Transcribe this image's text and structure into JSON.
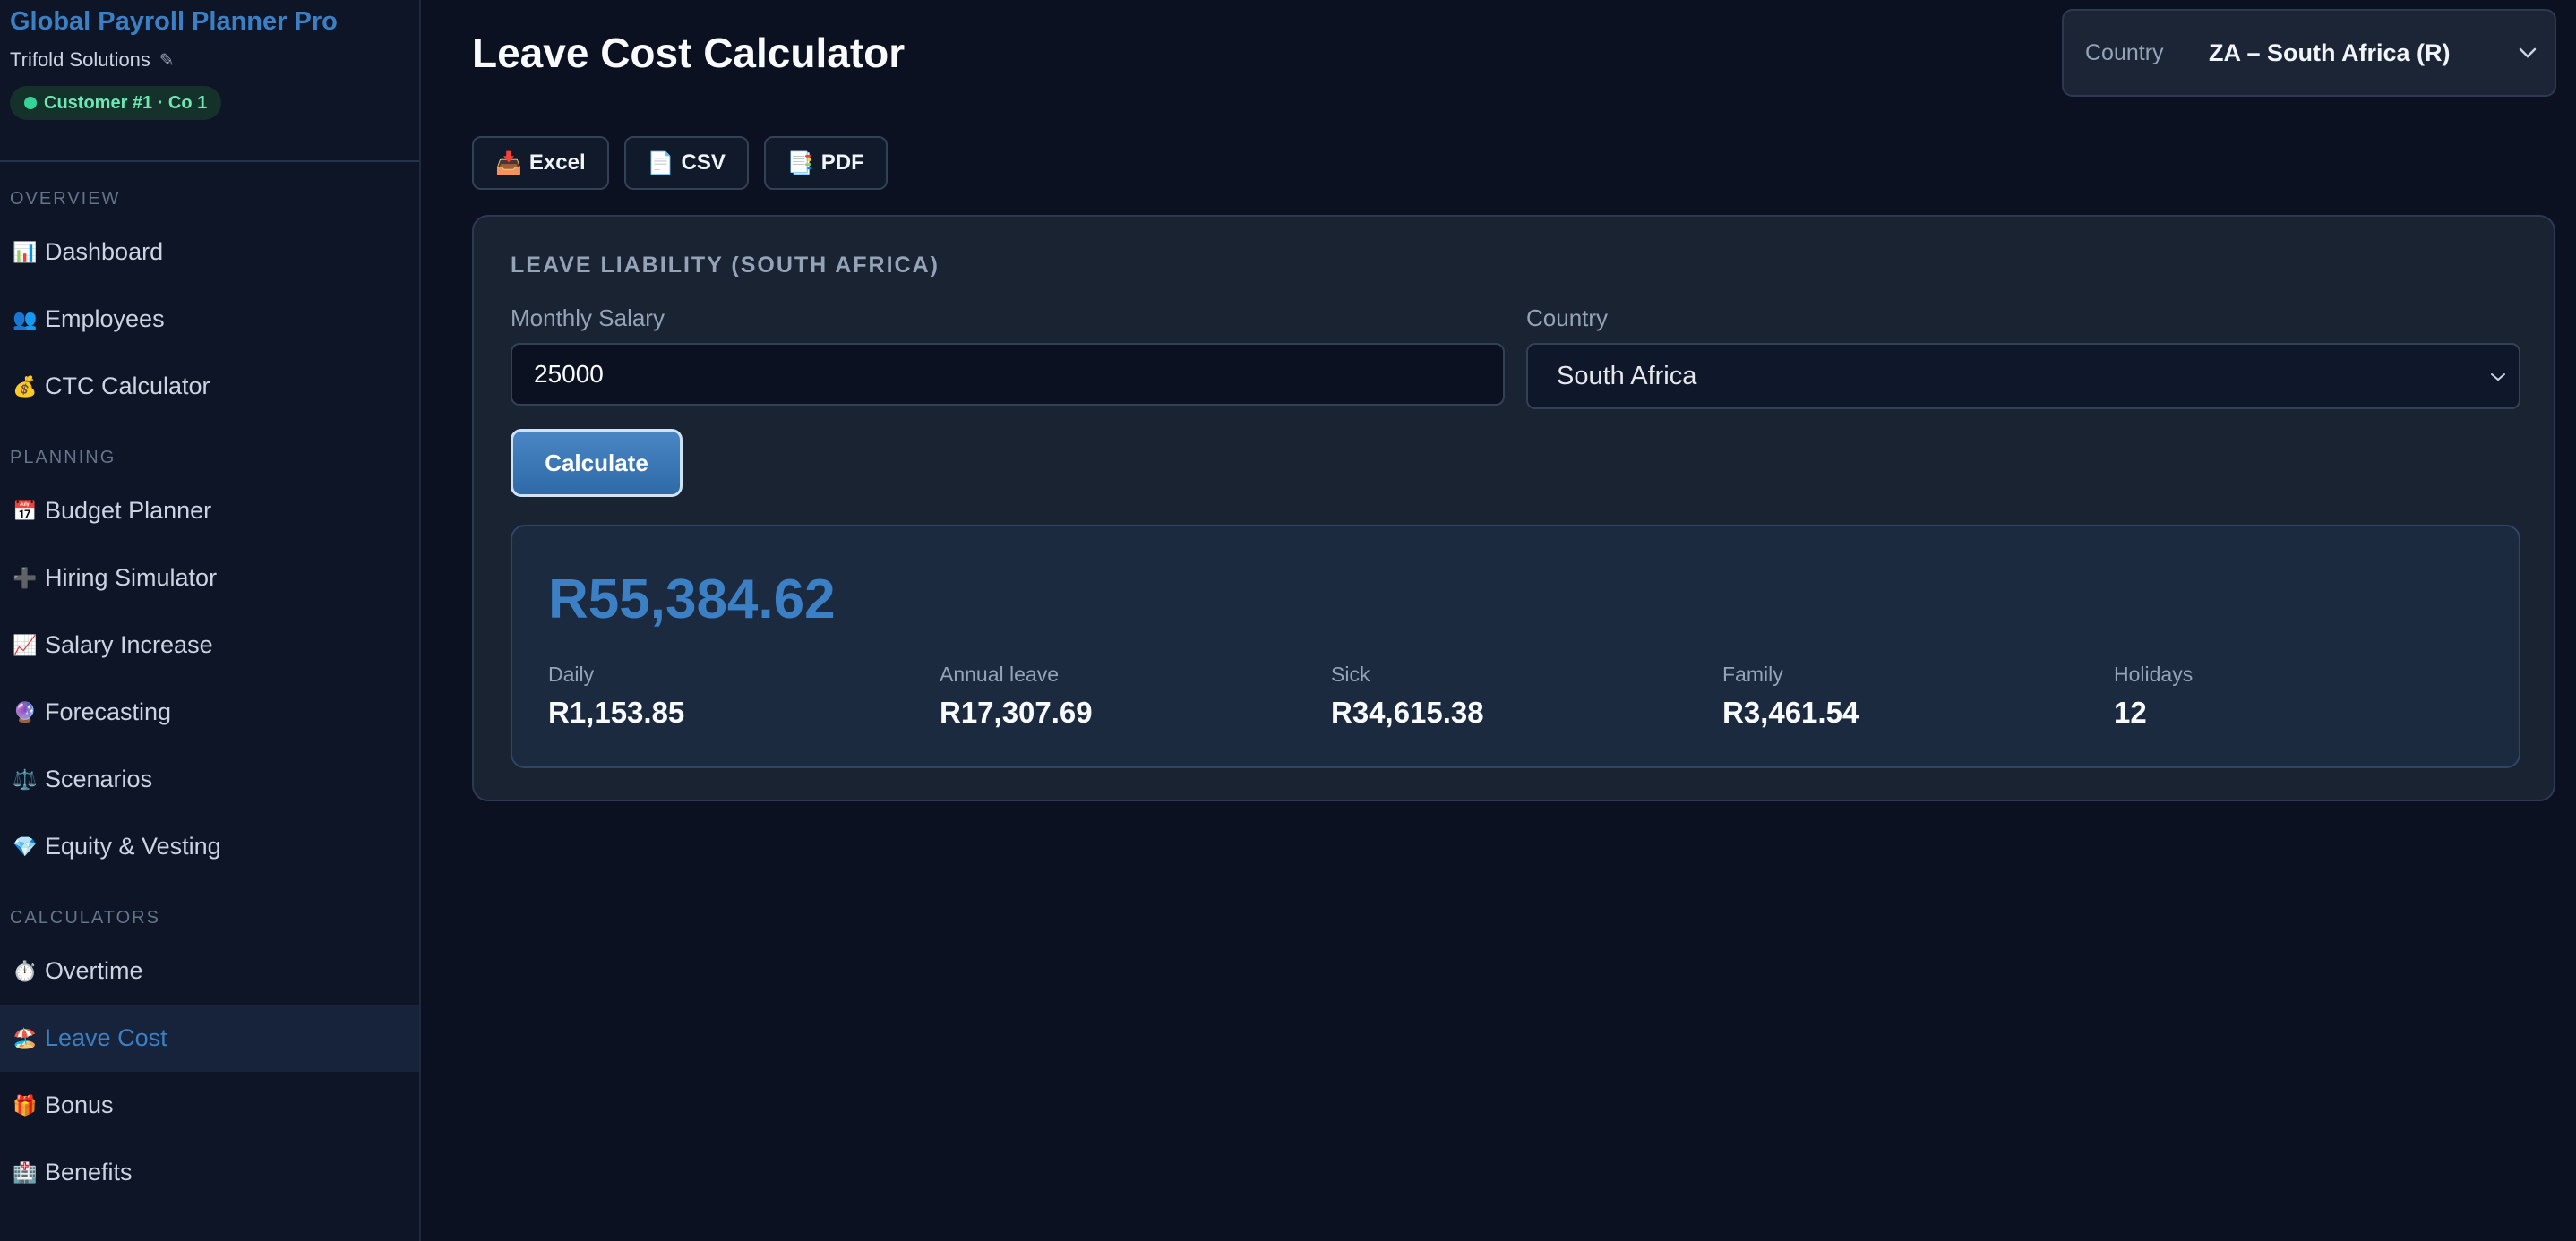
{
  "sidebar": {
    "brand_title": "Global Payroll Planner Pro",
    "company": "Trifold Solutions",
    "edit_glyph": "✎",
    "customer_badge": "Customer #1 · Co 1",
    "sections": {
      "overview": "OVERVIEW",
      "planning": "PLANNING",
      "calculators": "CALCULATORS"
    },
    "items": [
      {
        "icon": "📊",
        "label": "Dashboard"
      },
      {
        "icon": "👥",
        "label": "Employees"
      },
      {
        "icon": "💰",
        "label": "CTC Calculator"
      },
      {
        "icon": "📅",
        "label": "Budget Planner"
      },
      {
        "icon": "➕",
        "label": "Hiring Simulator"
      },
      {
        "icon": "📈",
        "label": "Salary Increase"
      },
      {
        "icon": "🔮",
        "label": "Forecasting"
      },
      {
        "icon": "⚖️",
        "label": "Scenarios"
      },
      {
        "icon": "💎",
        "label": "Equity & Vesting"
      },
      {
        "icon": "⏱️",
        "label": "Overtime"
      },
      {
        "icon": "🏖️",
        "label": "Leave Cost"
      },
      {
        "icon": "🎁",
        "label": "Bonus"
      },
      {
        "icon": "🏥",
        "label": "Benefits"
      }
    ],
    "active_item": "Leave Cost"
  },
  "header": {
    "title": "Leave Cost Calculator",
    "country_label": "Country",
    "country_value": "ZA – South Africa (R)"
  },
  "export": {
    "excel": "Excel",
    "excel_icon": "📥",
    "csv": "CSV",
    "csv_icon": "📄",
    "pdf": "PDF",
    "pdf_icon": "📑"
  },
  "card": {
    "title": "LEAVE LIABILITY (SOUTH AFRICA)",
    "salary_label": "Monthly Salary",
    "salary_value": "25000",
    "country_label": "Country",
    "country_value": "South Africa",
    "calculate_label": "Calculate"
  },
  "result": {
    "total": "R55,384.62",
    "stats": [
      {
        "label": "Daily",
        "value": "R1,153.85"
      },
      {
        "label": "Annual leave",
        "value": "R17,307.69"
      },
      {
        "label": "Sick",
        "value": "R34,615.38"
      },
      {
        "label": "Family",
        "value": "R3,461.54"
      },
      {
        "label": "Holidays",
        "value": "12"
      }
    ]
  },
  "colors": {
    "accent": "#3b7fc4",
    "background": "#0b1120",
    "badge_text": "#6ee7b7"
  }
}
